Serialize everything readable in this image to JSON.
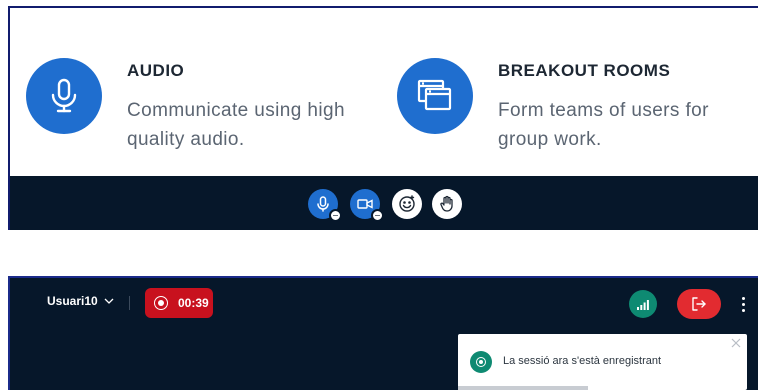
{
  "features": [
    {
      "title": "AUDIO",
      "description": "Communicate using high quality audio.",
      "icon": "microphone-icon"
    },
    {
      "title": "BREAKOUT ROOMS",
      "description": "Form teams of users for group work.",
      "icon": "breakout-rooms-icon"
    }
  ],
  "controls": [
    {
      "name": "microphone",
      "icon": "microphone-icon"
    },
    {
      "name": "camera",
      "icon": "video-camera-icon"
    },
    {
      "name": "reactions",
      "icon": "smiley-icon"
    },
    {
      "name": "raise-hand",
      "icon": "hand-icon"
    }
  ],
  "session_bar": {
    "user_name": "Usuari10",
    "recording_time": "00:39",
    "colors": {
      "record": "#c8111e",
      "connection": "#0e8a72",
      "leave": "#e22b30",
      "primary": "#1f6ecf"
    }
  },
  "toast": {
    "message": "La sessió ara s'està enregistrant",
    "progress": 0.45
  }
}
